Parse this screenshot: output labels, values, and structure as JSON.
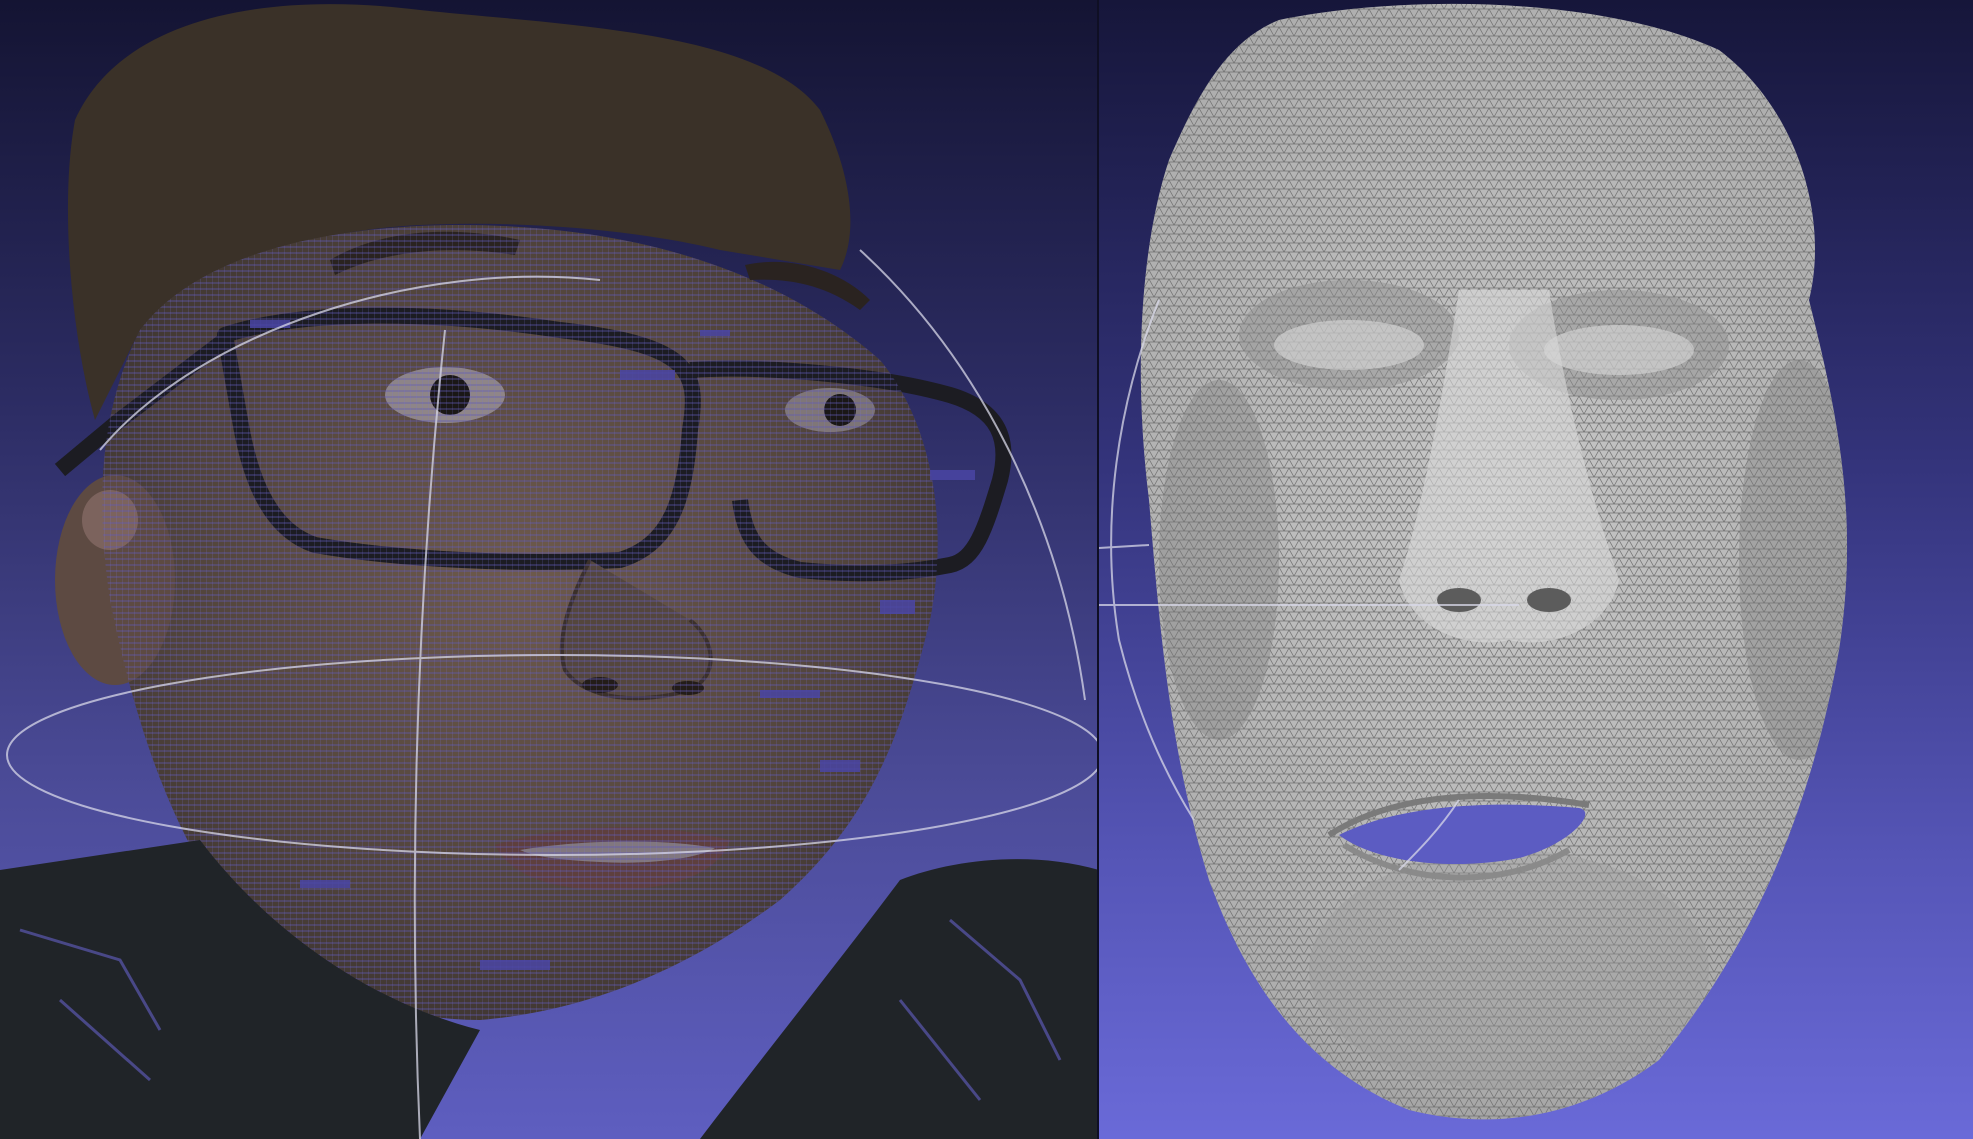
{
  "viewports": {
    "left": {
      "content": "textured-point-cloud",
      "trackball": "visible"
    },
    "right": {
      "content": "face-wireframe-mesh",
      "trackball": "visible"
    }
  },
  "colors": {
    "background_top": "#141433",
    "background_bottom": "#6a6ad8",
    "mesh_fill": "#b7b7b7",
    "mesh_wire": "#6f6f6f",
    "trackball": "#d8d8e8",
    "skin": "#6b5a4e",
    "hair": "#3a3026",
    "glasses": "#1c1c22",
    "shirt": "#202428"
  }
}
